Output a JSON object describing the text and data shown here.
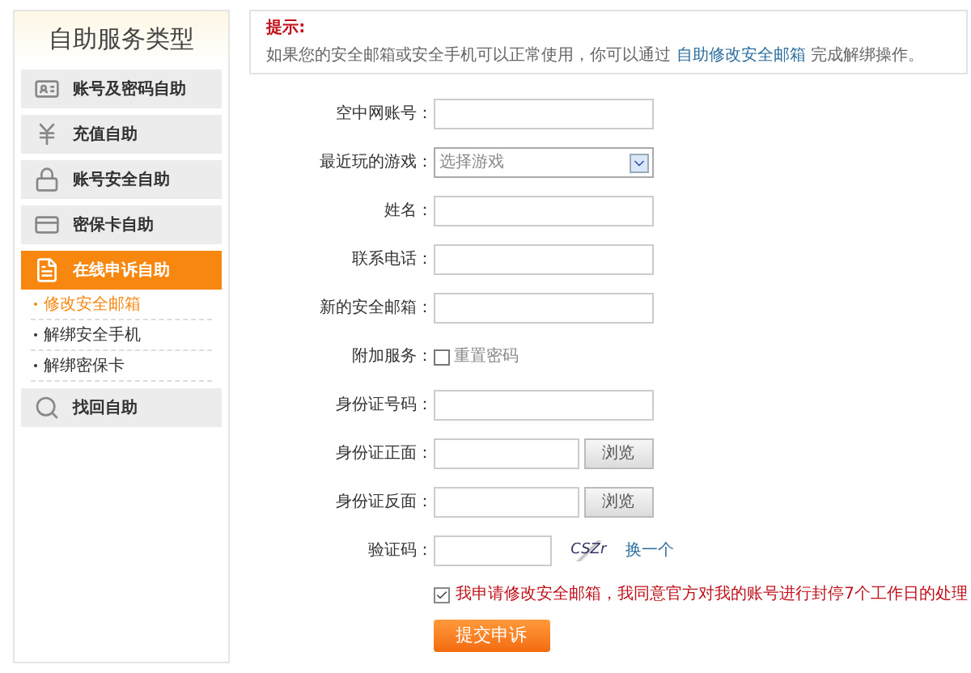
{
  "sidebar": {
    "title": "自助服务类型",
    "items": [
      {
        "label": "账号及密码自助",
        "selected": false
      },
      {
        "label": "充值自助",
        "selected": false
      },
      {
        "label": "账号安全自助",
        "selected": false
      },
      {
        "label": "密保卡自助",
        "selected": false
      },
      {
        "label": "在线申诉自助",
        "selected": true,
        "children": [
          {
            "label": "修改安全邮箱",
            "selected": true
          },
          {
            "label": "解绑安全手机",
            "selected": false
          },
          {
            "label": "解绑密保卡",
            "selected": false
          }
        ]
      },
      {
        "label": "找回自助",
        "selected": false
      }
    ]
  },
  "notice": {
    "title": "提示:",
    "text_before": "如果您的安全邮箱或安全手机可以正常使用，你可以通过",
    "link": "自助修改安全邮箱",
    "text_after": "完成解绑操作。"
  },
  "form": {
    "fields": [
      {
        "kind": "text",
        "label": "空中网账号："
      },
      {
        "kind": "select",
        "label": "最近玩的游戏：",
        "placeholder": "选择游戏"
      },
      {
        "kind": "text",
        "label": "姓名："
      },
      {
        "kind": "text",
        "label": "联系电话："
      },
      {
        "kind": "text",
        "label": "新的安全邮箱："
      },
      {
        "kind": "checkbox",
        "label": "附加服务：",
        "option": "重置密码",
        "checked": false
      },
      {
        "kind": "text",
        "label": "身份证号码："
      },
      {
        "kind": "file",
        "label": "身份证正面：",
        "button": "浏览"
      },
      {
        "kind": "file",
        "label": "身份证反面：",
        "button": "浏览"
      },
      {
        "kind": "captcha",
        "label": "验证码：",
        "captcha_text": "CSZr",
        "refresh": "换一个"
      }
    ],
    "agreement": {
      "text": "我申请修改安全邮箱，我同意官方对我的账号进行封停7个工作日的处理",
      "checked": true
    },
    "submit": "提交申诉"
  }
}
